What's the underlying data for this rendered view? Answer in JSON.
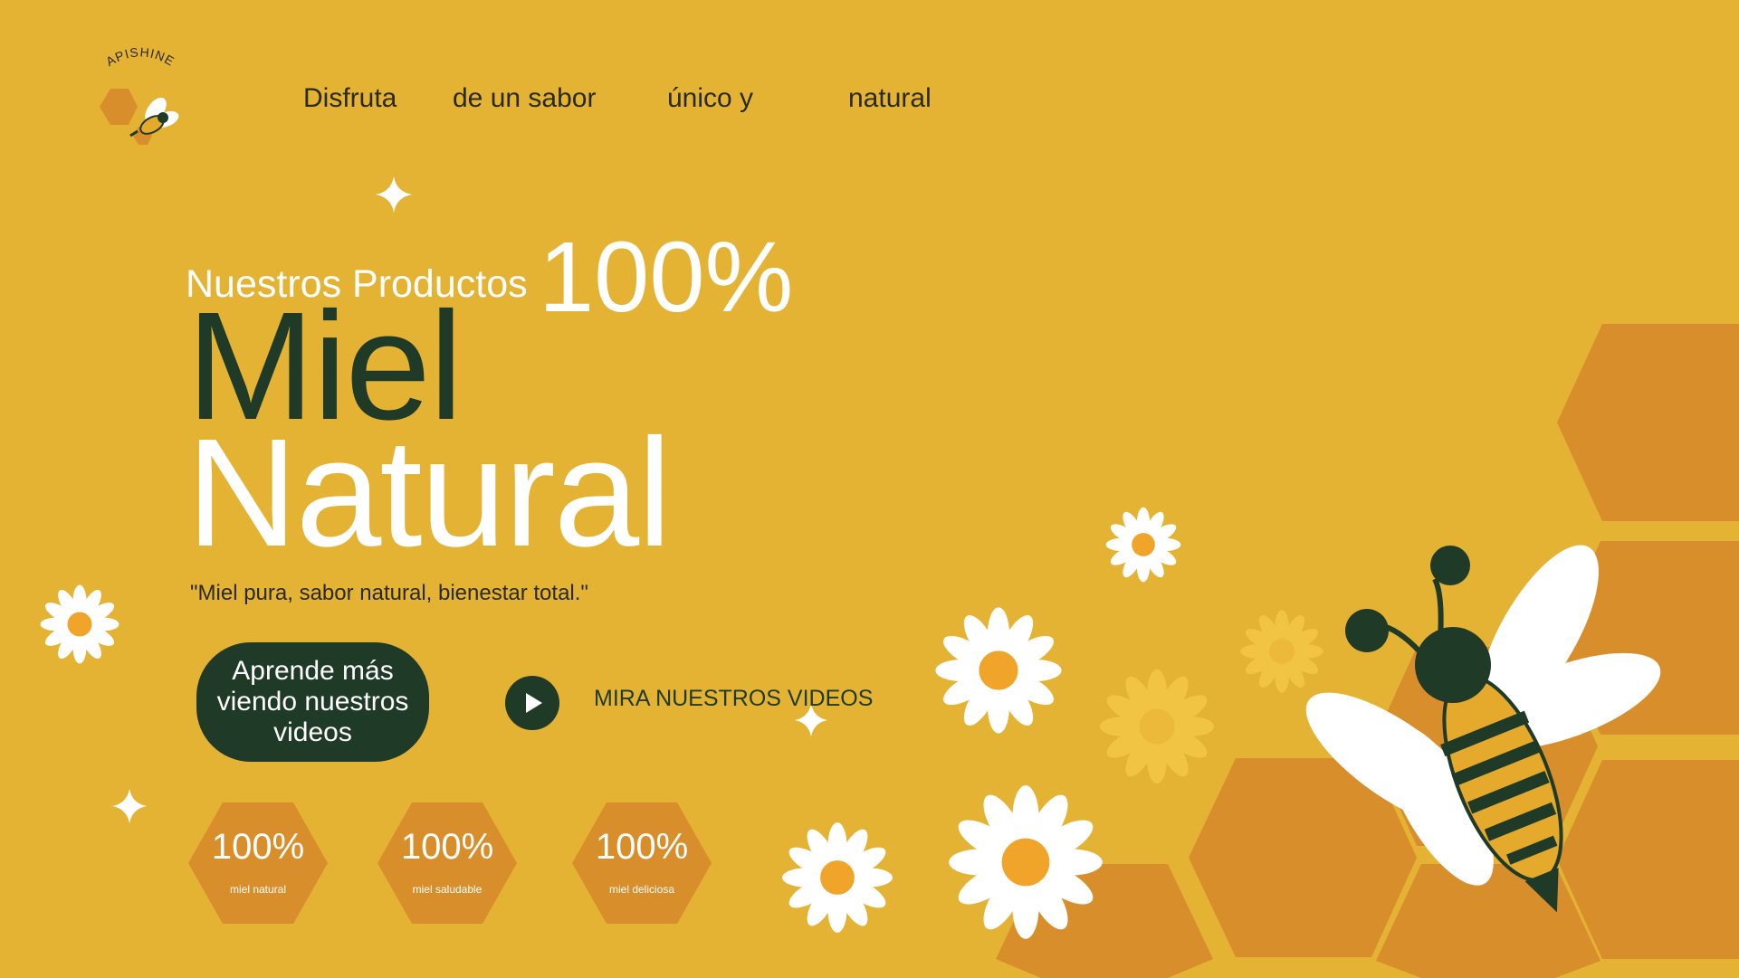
{
  "brand": {
    "name": "APISHINE"
  },
  "nav": {
    "items": [
      {
        "label": "Disfruta"
      },
      {
        "label": "de un sabor"
      },
      {
        "label": "único y"
      },
      {
        "label": "natural"
      }
    ]
  },
  "hero": {
    "eyebrow": "Nuestros Productos",
    "percent": "100%",
    "title_line1": "Miel",
    "title_line2": "Natural",
    "tagline": "\"Miel pura, sabor natural, bienestar total.\""
  },
  "cta": {
    "primary_label": "Aprende más viendo nuestros videos",
    "videos_link": "MIRA NUESTROS VIDEOS"
  },
  "stats": [
    {
      "value": "100%",
      "label": "miel natural"
    },
    {
      "value": "100%",
      "label": "miel saludable"
    },
    {
      "value": "100%",
      "label": "miel deliciosa"
    }
  ],
  "colors": {
    "background": "#e5b333",
    "honeycomb": "#d98e2c",
    "dark_green": "#1f3a26",
    "white": "#ffffff",
    "flower_center": "#f0a52a"
  },
  "icons": [
    "bee-icon",
    "play-icon",
    "sparkle-icon",
    "flower-icon",
    "honeycomb-icon"
  ]
}
